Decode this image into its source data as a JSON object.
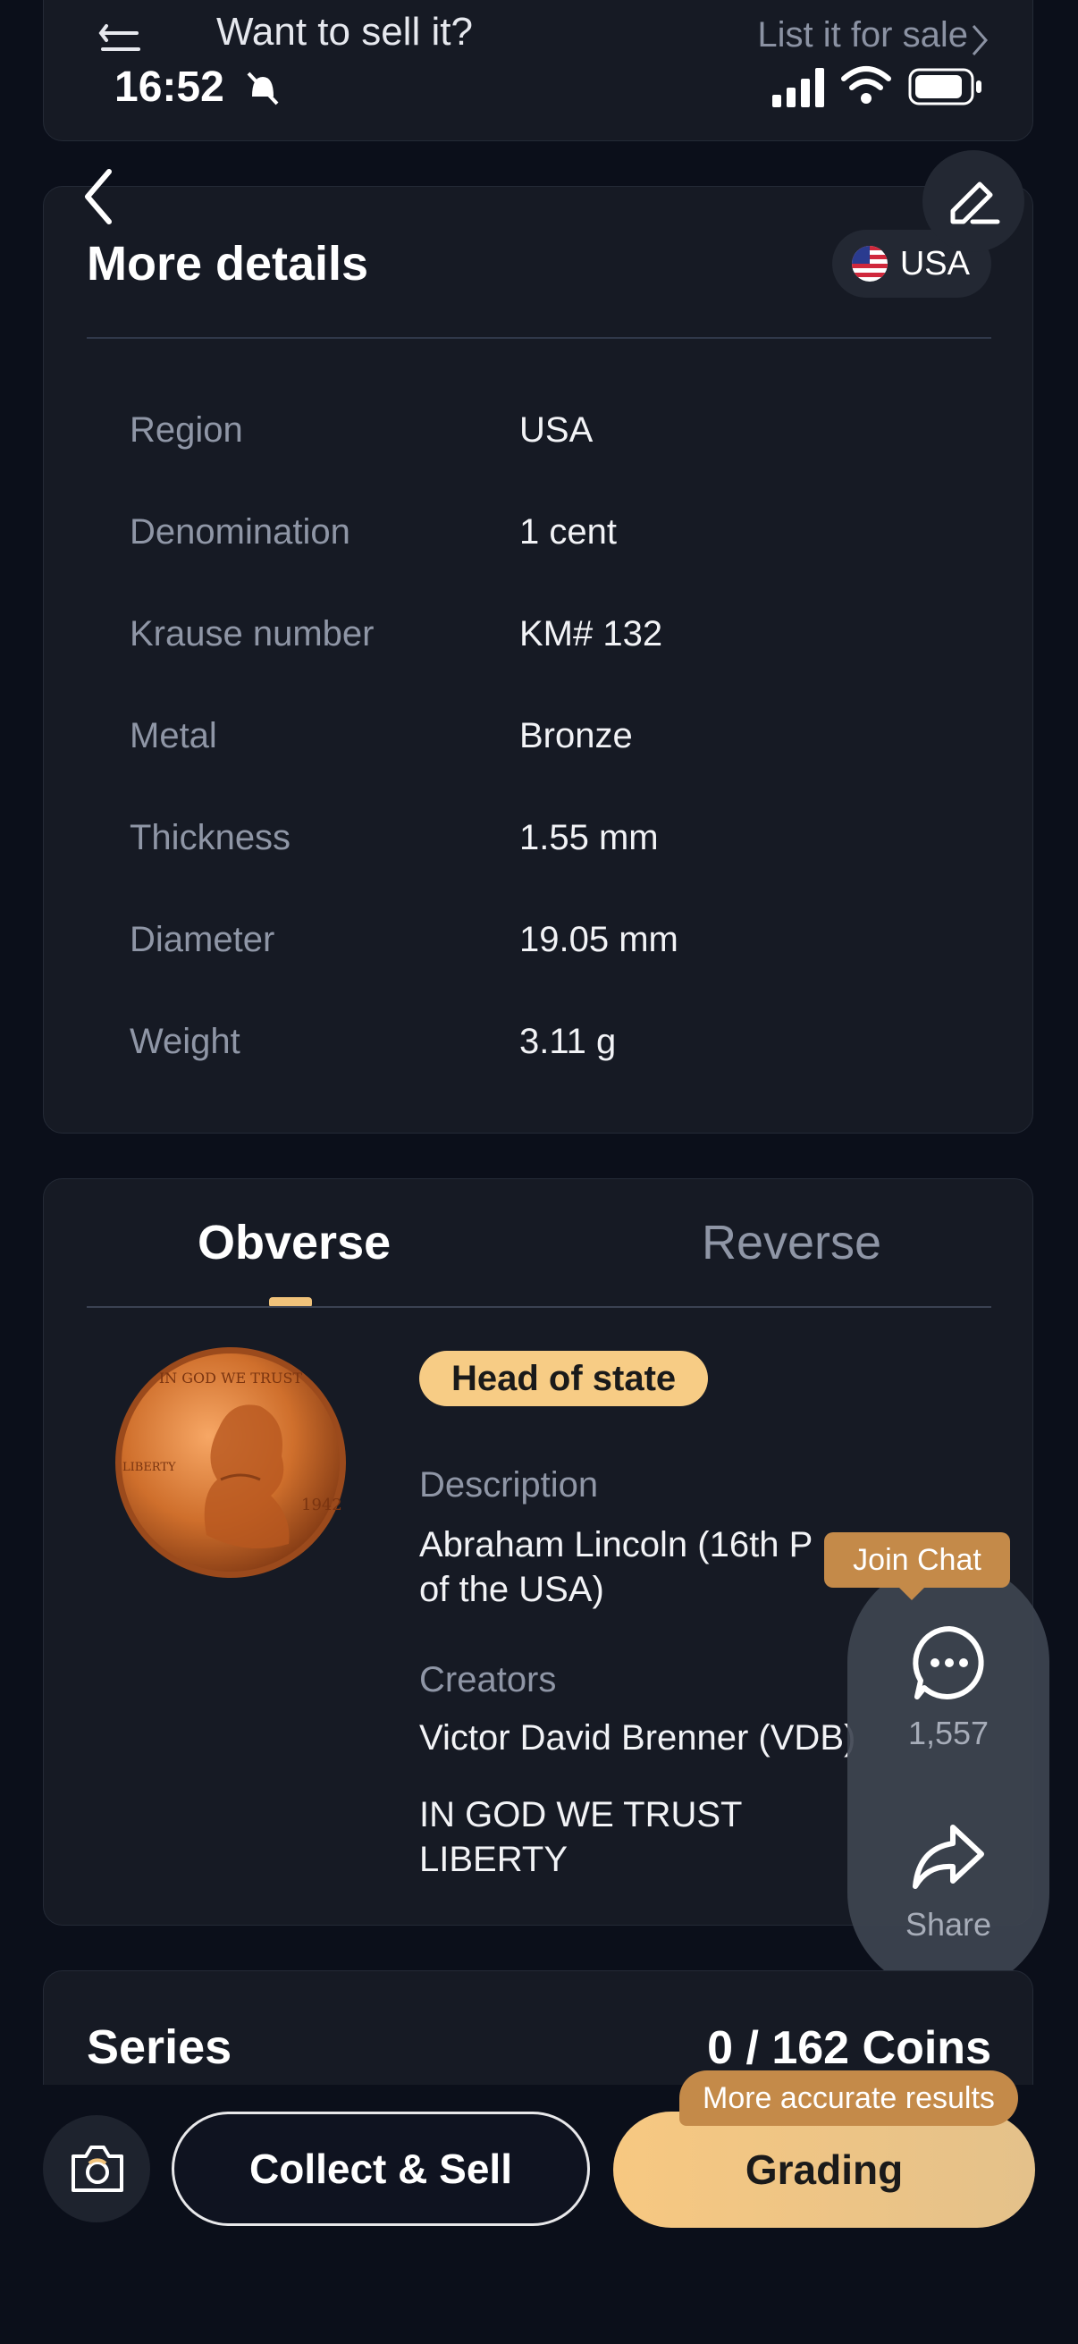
{
  "status_bar": {
    "time": "16:52"
  },
  "sell_banner": {
    "text": "Want to sell it?",
    "link": "List it for sale"
  },
  "details": {
    "title": "More details",
    "region_chip": "USA",
    "rows": [
      {
        "label": "Region",
        "value": "USA"
      },
      {
        "label": "Denomination",
        "value": "1 cent"
      },
      {
        "label": "Krause number",
        "value": "KM# 132"
      },
      {
        "label": "Metal",
        "value": "Bronze"
      },
      {
        "label": "Thickness",
        "value": "1.55 mm"
      },
      {
        "label": "Diameter",
        "value": "19.05 mm"
      },
      {
        "label": "Weight",
        "value": "3.11 g"
      }
    ]
  },
  "coin": {
    "tabs": [
      "Obverse",
      "Reverse"
    ],
    "badge": "Head of state",
    "description_label": "Description",
    "description_line1": "Abraham Lincoln (16th P",
    "description_line2": "of the USA)",
    "creators_label": "Creators",
    "creators_value": "Victor David Brenner (VDB)",
    "inscription_line1": "IN GOD WE TRUST",
    "inscription_line2": "LIBERTY",
    "coin_text_top": "IN GOD WE TRUST",
    "coin_text_left": "LIBERTY",
    "coin_year": "1942"
  },
  "floating": {
    "join_chat": "Join Chat",
    "chat_count": "1,557",
    "share_label": "Share",
    "icons": [
      "chat-bubble-icon",
      "share-arrow-icon"
    ]
  },
  "series": {
    "title": "Series",
    "count": "0 / 162 Coins"
  },
  "bottom": {
    "collect_label": "Collect & Sell",
    "grading_label": "Grading",
    "accurate_tag": "More accurate results"
  },
  "colors": {
    "accent": "#f7cc85",
    "tag": "#c48a49",
    "background": "#0b0f1a",
    "card": "#161a24"
  }
}
